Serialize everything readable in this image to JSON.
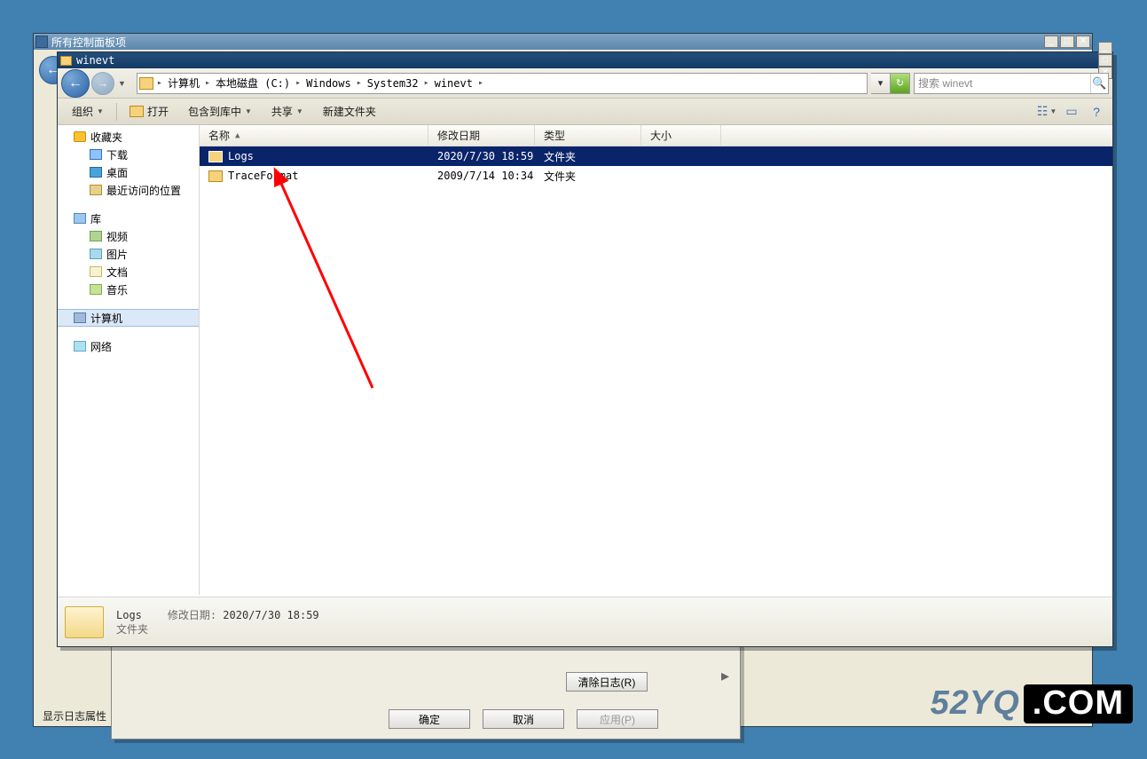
{
  "back_window": {
    "title": "所有控制面板项"
  },
  "dialog_bg": {
    "clear_log_btn": "清除日志(R)",
    "ok": "确定",
    "cancel": "取消",
    "apply": "应用(P)"
  },
  "status_bg": "显示日志属性",
  "explorer": {
    "title": "winevt",
    "path_segments": [
      "计算机",
      "本地磁盘 (C:)",
      "Windows",
      "System32",
      "winevt"
    ],
    "search_placeholder": "搜索 winevt",
    "toolbar": {
      "org": "组织",
      "open": "打开",
      "include": "包含到库中",
      "share": "共享",
      "newfolder": "新建文件夹"
    },
    "columns": {
      "name": "名称",
      "date": "修改日期",
      "type": "类型",
      "size": "大小"
    },
    "rows": [
      {
        "name": "Logs",
        "date": "2020/7/30 18:59",
        "type": "文件夹",
        "selected": true
      },
      {
        "name": "TraceFormat",
        "date": "2009/7/14 10:34",
        "type": "文件夹",
        "selected": false
      }
    ],
    "sidebar": {
      "favorites": {
        "label": "收藏夹",
        "items": [
          {
            "label": "下载",
            "ico": "dl"
          },
          {
            "label": "桌面",
            "ico": "desk"
          },
          {
            "label": "最近访问的位置",
            "ico": "rec"
          }
        ]
      },
      "library": {
        "label": "库",
        "items": [
          {
            "label": "视频",
            "ico": "vid"
          },
          {
            "label": "图片",
            "ico": "pic"
          },
          {
            "label": "文档",
            "ico": "doc"
          },
          {
            "label": "音乐",
            "ico": "mus"
          }
        ]
      },
      "computer": {
        "label": "计算机"
      },
      "network": {
        "label": "网络"
      }
    },
    "details": {
      "name": "Logs",
      "date_label": "修改日期:",
      "date": "2020/7/30 18:59",
      "type": "文件夹"
    }
  },
  "watermark": {
    "left": "52YQ",
    "right": ".COM"
  }
}
